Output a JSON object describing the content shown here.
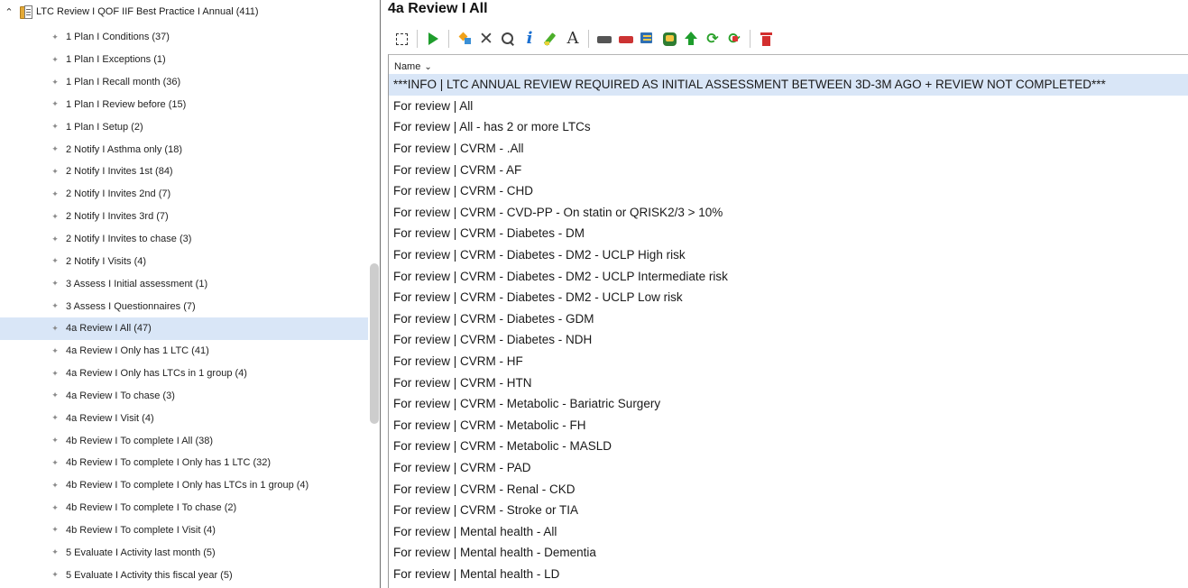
{
  "tree": {
    "root_label": "LTC Review I QOF IIF Best Practice I Annual (411)",
    "items": [
      {
        "label": "1 Plan I Conditions (37)"
      },
      {
        "label": "1 Plan I Exceptions (1)"
      },
      {
        "label": "1 Plan I Recall month (36)"
      },
      {
        "label": "1 Plan I Review before (15)"
      },
      {
        "label": "1 Plan I Setup (2)"
      },
      {
        "label": "2 Notify I Asthma only (18)"
      },
      {
        "label": "2 Notify I Invites 1st (84)"
      },
      {
        "label": "2 Notify I Invites 2nd (7)"
      },
      {
        "label": "2 Notify I Invites 3rd (7)"
      },
      {
        "label": "2 Notify I Invites to chase (3)"
      },
      {
        "label": "2 Notify I Visits (4)"
      },
      {
        "label": "3 Assess I Initial assessment (1)"
      },
      {
        "label": "3 Assess I Questionnaires (7)"
      },
      {
        "label": "4a Review I All (47)",
        "selected": true
      },
      {
        "label": "4a Review I Only has 1 LTC (41)"
      },
      {
        "label": "4a Review I Only has LTCs in 1 group (4)"
      },
      {
        "label": "4a Review I To chase (3)"
      },
      {
        "label": "4a Review I Visit (4)"
      },
      {
        "label": "4b Review I To complete I All (38)"
      },
      {
        "label": "4b Review I To complete I Only has 1 LTC (32)"
      },
      {
        "label": "4b Review I To complete I Only has LTCs in 1 group (4)"
      },
      {
        "label": "4b Review I To complete I To chase (2)"
      },
      {
        "label": "4b Review I To complete I Visit (4)"
      },
      {
        "label": "5 Evaluate I Activity last month (5)"
      },
      {
        "label": "5 Evaluate I Activity this fiscal year (5)"
      }
    ]
  },
  "report": {
    "title": "4a Review I All",
    "column_header": "Name",
    "rows": [
      {
        "text": "***INFO | LTC ANNUAL REVIEW REQUIRED AS INITIAL ASSESSMENT BETWEEN 3D-3M AGO + REVIEW NOT COMPLETED***",
        "highlight": true
      },
      {
        "text": "For review | All"
      },
      {
        "text": "For review | All - has 2 or more LTCs"
      },
      {
        "text": "For review | CVRM - .All"
      },
      {
        "text": "For review | CVRM - AF"
      },
      {
        "text": "For review | CVRM - CHD"
      },
      {
        "text": "For review | CVRM - CVD-PP - On statin or QRISK2/3 > 10%"
      },
      {
        "text": "For review | CVRM - Diabetes - DM"
      },
      {
        "text": "For review | CVRM - Diabetes - DM2 - UCLP High risk"
      },
      {
        "text": "For review | CVRM - Diabetes - DM2 - UCLP Intermediate risk"
      },
      {
        "text": "For review | CVRM - Diabetes - DM2 - UCLP Low risk"
      },
      {
        "text": "For review | CVRM - Diabetes - GDM"
      },
      {
        "text": "For review | CVRM - Diabetes - NDH"
      },
      {
        "text": "For review | CVRM - HF"
      },
      {
        "text": "For review | CVRM - HTN"
      },
      {
        "text": "For review | CVRM - Metabolic - Bariatric Surgery"
      },
      {
        "text": "For review | CVRM - Metabolic - FH"
      },
      {
        "text": "For review | CVRM - Metabolic - MASLD"
      },
      {
        "text": "For review | CVRM - PAD"
      },
      {
        "text": "For review | CVRM - Renal - CKD"
      },
      {
        "text": "For review | CVRM - Stroke or TIA"
      },
      {
        "text": "For review | Mental health - All"
      },
      {
        "text": "For review | Mental health - Dementia"
      },
      {
        "text": "For review | Mental health - LD"
      }
    ]
  },
  "toolbar": {
    "icons": [
      "select-icon",
      "run-icon",
      "wizard-icon",
      "delete-x-icon",
      "search-icon",
      "info-icon",
      "edit-pen-icon",
      "font-icon",
      "print-icon",
      "print-red-icon",
      "export-icon",
      "save-icon",
      "move-up-icon",
      "refresh-icon",
      "refresh-stop-icon",
      "trash-icon"
    ]
  },
  "colors": {
    "selection": "#d9e6f7",
    "run_green": "#1e9d2c",
    "delete_red": "#d32f2f",
    "info_blue": "#1a6fd1"
  }
}
